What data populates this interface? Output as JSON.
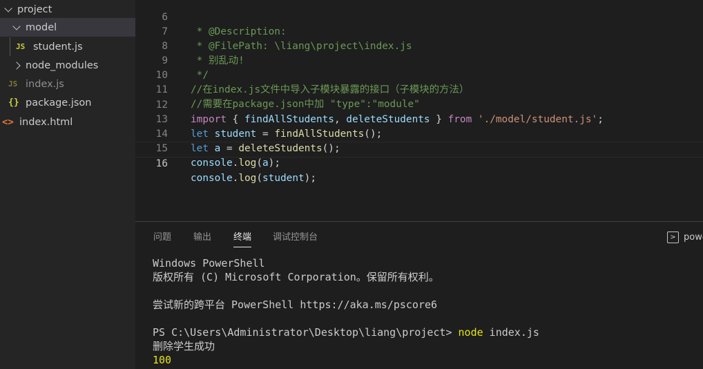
{
  "explorer": {
    "items": [
      {
        "label": "project",
        "kind": "folder-open",
        "icon": "chevron-down-icon"
      },
      {
        "label": "model",
        "kind": "folder-open",
        "icon": "chevron-down-icon"
      },
      {
        "label": "student.js",
        "kind": "file-js",
        "icon": "js-file-icon",
        "icon_text": "JS"
      },
      {
        "label": "node_modules",
        "kind": "folder-closed",
        "icon": "chevron-right-icon"
      },
      {
        "label": "index.js",
        "kind": "file-js",
        "icon": "js-file-icon",
        "icon_text": "JS"
      },
      {
        "label": "package.json",
        "kind": "file-json",
        "icon": "json-file-icon",
        "icon_text": "{}"
      },
      {
        "label": "index.html",
        "kind": "file-html",
        "icon": "html-file-icon",
        "icon_text": "<>"
      }
    ]
  },
  "editor": {
    "lines": [
      {
        "n": "6",
        "text": " * @Description:"
      },
      {
        "n": "7",
        "text": " * @FilePath: \\liang\\project\\index.js"
      },
      {
        "n": "8",
        "text": " * 别乱动!"
      },
      {
        "n": "9",
        "text": " */"
      },
      {
        "n": "10",
        "text": "//在index.js文件中导入子模块暴露的接口（子模块的方法）"
      },
      {
        "n": "11",
        "text": "//需要在package.json中加 \"type\":\"module\""
      },
      {
        "n": "12",
        "tokens": [
          "import",
          " { ",
          "findAllStudents",
          ", ",
          "deleteStudents",
          " } ",
          "from",
          " ",
          "'./model/student.js'",
          ";"
        ]
      },
      {
        "n": "13",
        "tokens": [
          "let",
          " ",
          "student",
          " = ",
          "findAllStudents",
          "();"
        ]
      },
      {
        "n": "14",
        "tokens": [
          "let",
          " ",
          "a",
          " = ",
          "deleteStudents",
          "();"
        ]
      },
      {
        "n": "15",
        "tokens": [
          "console",
          ".",
          "log",
          "(",
          "a",
          ");"
        ]
      },
      {
        "n": "16",
        "tokens": [
          "console",
          ".",
          "log",
          "(",
          "student",
          ");"
        ]
      }
    ]
  },
  "panel": {
    "tabs": [
      "问题",
      "输出",
      "终端",
      "调试控制台"
    ],
    "active_tab": "终端",
    "terminal_select": "powe",
    "terminal_lines": [
      "Windows PowerShell",
      "版权所有 (C) Microsoft Corporation。保留所有权利。",
      "",
      "尝试新的跨平台 PowerShell https://aka.ms/pscore6",
      ""
    ],
    "prompt": "PS C:\\Users\\Administrator\\Desktop\\liang\\project> ",
    "command": "node",
    "command_args": " index.js",
    "output_line": "删除学生成功",
    "output_value": "100"
  },
  "colors": {
    "comment": "#6a9955",
    "keyword": "#c586c0",
    "declaration": "#569cd6",
    "variable": "#9cdcfe",
    "function": "#dcdcaa",
    "string": "#ce9178",
    "terminal_highlight": "#e5e510"
  }
}
